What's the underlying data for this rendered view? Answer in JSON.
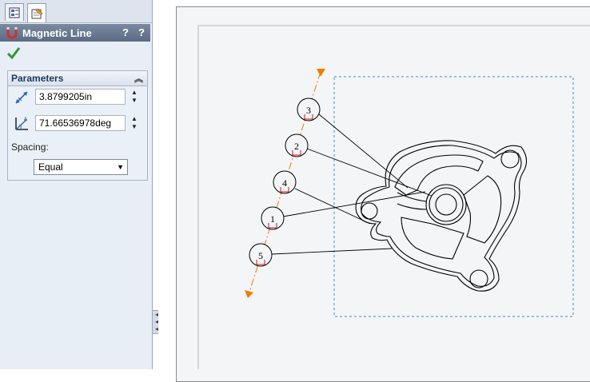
{
  "property_manager": {
    "title": "Magnetic Line",
    "parameters_header": "Parameters",
    "length_value": "3.8799205in",
    "angle_value": "71.66536978deg",
    "spacing_label": "Spacing:",
    "spacing_value": "Equal",
    "qhelp_glyph": "?",
    "help_glyph": "?"
  },
  "balloons": [
    "3",
    "2",
    "4",
    "1",
    "5"
  ],
  "colors": {
    "magnetic_line": "#f07c00",
    "selection_box": "#3a8ad8",
    "ok_check": "#2f9a2f",
    "title_bar": "#5b6b84"
  },
  "icons": [
    "feature-manager-tab-icon",
    "property-manager-tab-icon",
    "magnetic-line-icon",
    "ok-check-icon",
    "length-icon",
    "angle-icon"
  ]
}
